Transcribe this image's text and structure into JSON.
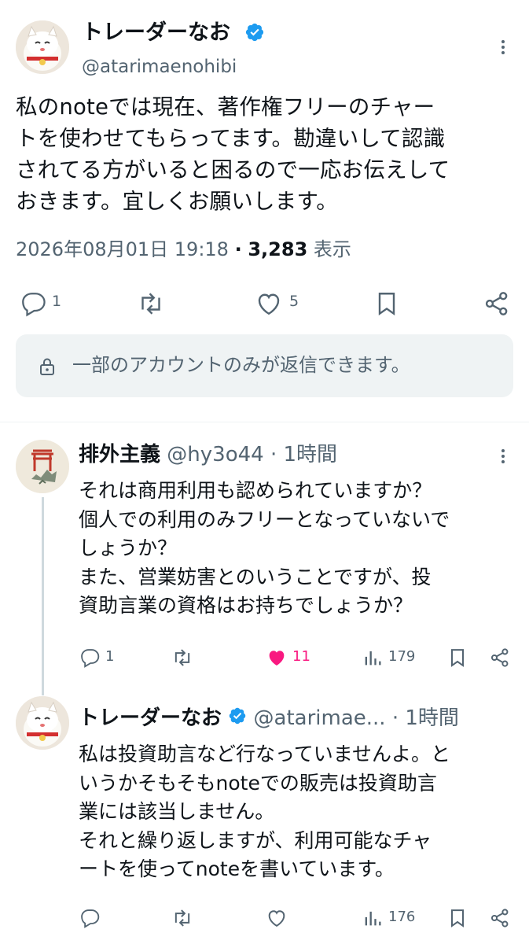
{
  "main_post": {
    "author_name": "トレーダーなお",
    "author_handle": "@atarimaenohibi",
    "text": "私のnoteでは現在、著作権フリーのチャー\nトを使わせてもらってます。勘違いして認識\nされてる方がいると困るので一応お伝えして\nおきます。宜しくお願いします。",
    "timestamp": "2026年08月01日 19:18",
    "separator": "·",
    "view_count": "3,283",
    "view_label": "表示",
    "reply_count": "1",
    "like_count": "5",
    "reply_restriction": "一部のアカウントのみが返信できます。"
  },
  "replies": [
    {
      "author_name": "排外主義",
      "author_handle": "@hy3o44",
      "time": "· 1時間",
      "text": "それは商用利用も認められていますか？\n個人での利用のみフリーとなっていないで\nしょうか？\nまた、営業妨害とのいうことですが、投\n資助言業の資格はお持ちでしょうか？",
      "reply_count": "1",
      "like_count": "11",
      "view_count": "179",
      "liked": true
    },
    {
      "author_name": "トレーダーなお",
      "author_handle": "@atarimae...",
      "time": "· 1時間",
      "text": "私は投資助言など行なっていませんよ。と\nいうかそもそもnoteでの販売は投資助言\n業には該当しません。\nそれと繰り返しますが、利用可能なチャ\nートを使ってnoteを書いています。",
      "reply_count": "",
      "like_count": "",
      "view_count": "176",
      "liked": false
    }
  ],
  "colors": {
    "verified": "#1d9bf0",
    "like_active": "#f91880",
    "muted": "#536471",
    "banner_bg": "#eff3f4"
  },
  "icons": [
    "verified-badge-icon",
    "more-icon",
    "reply-icon",
    "retweet-icon",
    "like-icon",
    "bookmark-icon",
    "share-icon",
    "lock-icon",
    "views-icon"
  ]
}
